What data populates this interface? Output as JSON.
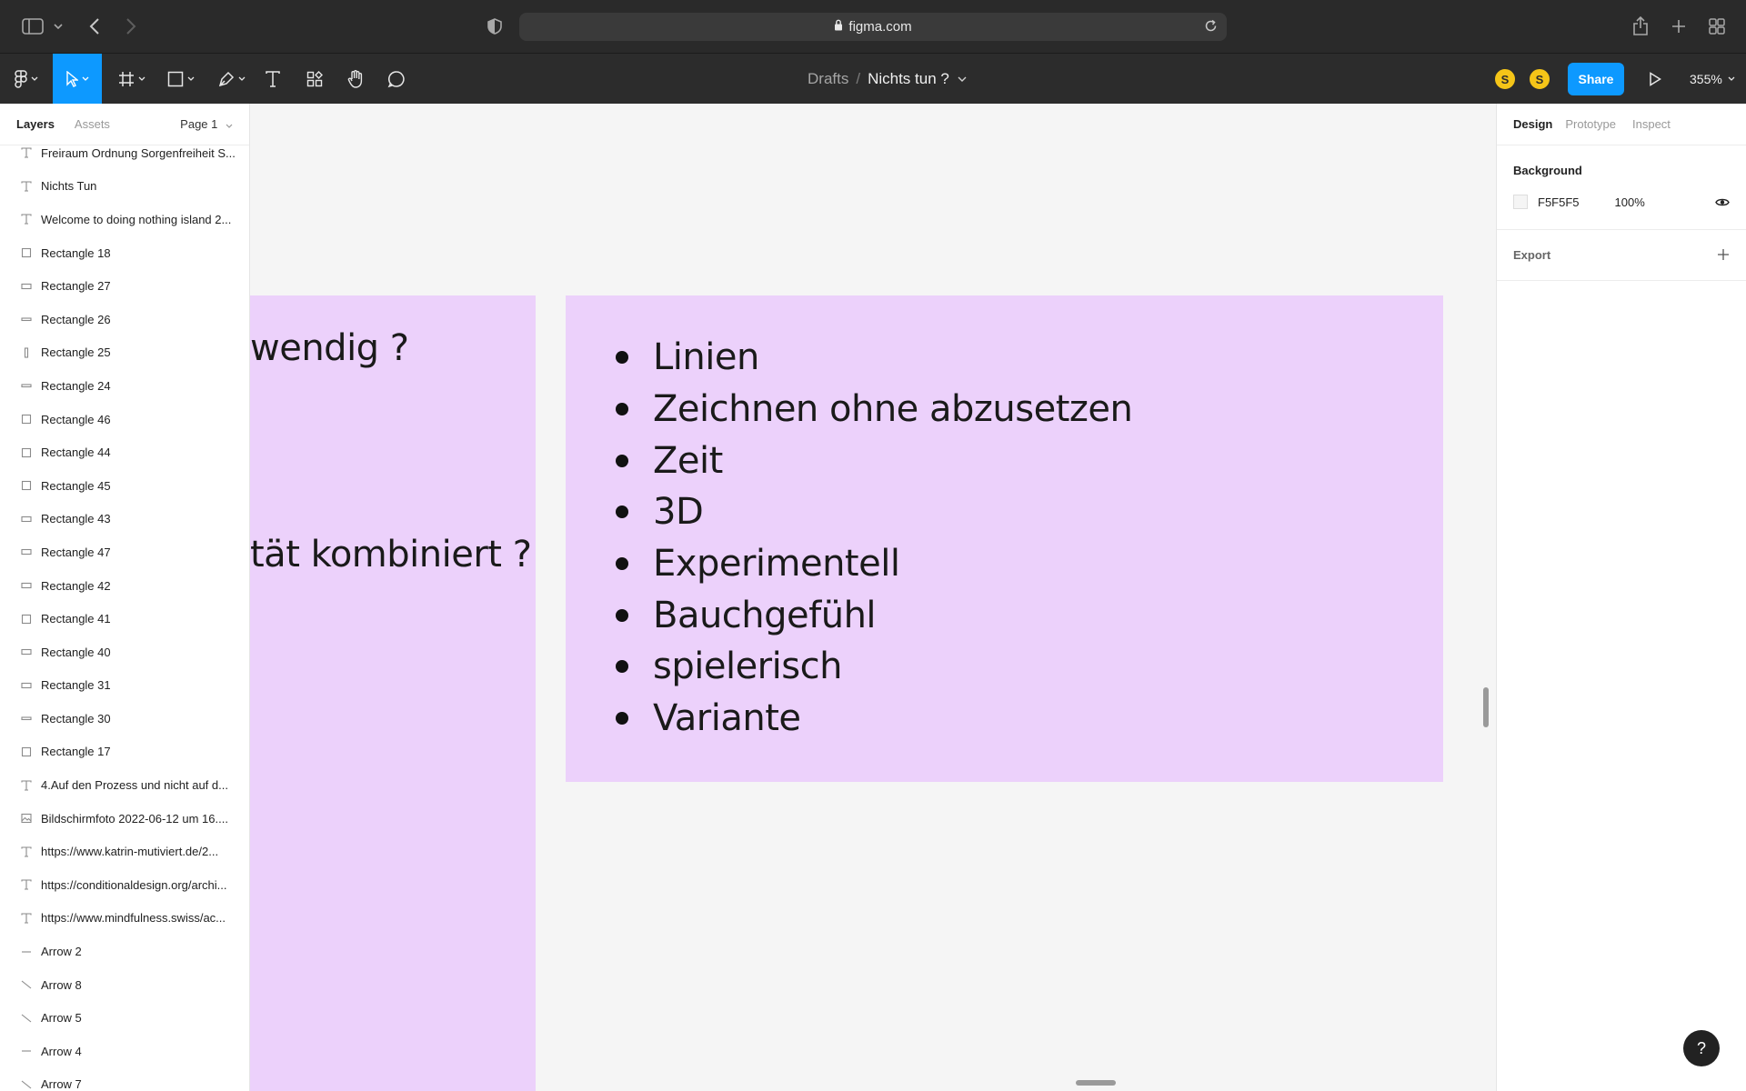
{
  "browser": {
    "url": "figma.com"
  },
  "toolbar": {
    "breadcrumb": "Drafts",
    "separator": "/",
    "file_name": "Nichts tun ?",
    "avatars": [
      "S",
      "S"
    ],
    "share_label": "Share",
    "zoom": "355%"
  },
  "left_panel": {
    "tabs": [
      "Layers",
      "Assets"
    ],
    "page": "Page 1",
    "layers": [
      {
        "icon": "text-icon",
        "name": "Freiraum Ordnung Sorgenfreiheit S..."
      },
      {
        "icon": "text-icon",
        "name": "Nichts Tun"
      },
      {
        "icon": "text-icon",
        "name": "Welcome to doing nothing island 2..."
      },
      {
        "icon": "rectangle-icon",
        "name": "Rectangle 18"
      },
      {
        "icon": "rectangle-wide-icon",
        "name": "Rectangle 27"
      },
      {
        "icon": "rectangle-thin-icon",
        "name": "Rectangle 26"
      },
      {
        "icon": "rectangle-tall-icon",
        "name": "Rectangle 25"
      },
      {
        "icon": "rectangle-thin-icon",
        "name": "Rectangle 24"
      },
      {
        "icon": "rectangle-icon",
        "name": "Rectangle 46"
      },
      {
        "icon": "rectangle-icon",
        "name": "Rectangle 44"
      },
      {
        "icon": "rectangle-icon",
        "name": "Rectangle 45"
      },
      {
        "icon": "rectangle-wide-icon",
        "name": "Rectangle 43"
      },
      {
        "icon": "rectangle-wide-icon",
        "name": "Rectangle 47"
      },
      {
        "icon": "rectangle-wide-icon",
        "name": "Rectangle 42"
      },
      {
        "icon": "rectangle-icon",
        "name": "Rectangle 41"
      },
      {
        "icon": "rectangle-wide-icon",
        "name": "Rectangle 40"
      },
      {
        "icon": "rectangle-wide-icon",
        "name": "Rectangle 31"
      },
      {
        "icon": "rectangle-thin-icon",
        "name": "Rectangle 30"
      },
      {
        "icon": "rectangle-icon",
        "name": "Rectangle 17"
      },
      {
        "icon": "text-icon",
        "name": "4.Auf den Prozess und nicht auf d..."
      },
      {
        "icon": "image-icon",
        "name": "Bildschirmfoto 2022-06-12 um 16...."
      },
      {
        "icon": "text-icon",
        "name": "https://www.katrin-mutiviert.de/2..."
      },
      {
        "icon": "text-icon",
        "name": "https://conditionaldesign.org/archi..."
      },
      {
        "icon": "text-icon",
        "name": "https://www.mindfulness.swiss/ac..."
      },
      {
        "icon": "line-icon",
        "name": "Arrow 2"
      },
      {
        "icon": "diagonal-line-icon",
        "name": "Arrow 8"
      },
      {
        "icon": "diagonal-line-icon",
        "name": "Arrow 5"
      },
      {
        "icon": "line-icon",
        "name": "Arrow 4"
      },
      {
        "icon": "diagonal-line-icon",
        "name": "Arrow 7"
      }
    ]
  },
  "canvas": {
    "left_fragments": [
      "wendig ?",
      "tät kombiniert ?"
    ],
    "bullets": [
      "Linien",
      "Zeichnen ohne abzusetzen",
      "Zeit",
      "3D",
      "Experimentell",
      "Bauchgefühl",
      "spielerisch",
      "Variante"
    ],
    "frame_color": "#ECD1FB"
  },
  "right_panel": {
    "tabs": [
      "Design",
      "Prototype",
      "Inspect"
    ],
    "background_title": "Background",
    "background_hex": "F5F5F5",
    "background_opacity": "100%",
    "export_title": "Export"
  },
  "help": "?"
}
